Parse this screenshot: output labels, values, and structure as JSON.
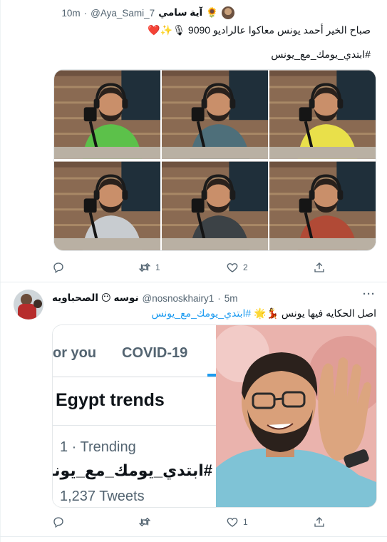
{
  "tweet1": {
    "display_name": "آية سامي",
    "name_emoji": "🌻",
    "handle": "@Aya_Sami_7",
    "dot": "·",
    "time": "10m",
    "text_line1": "صباح الخير أحمد يونس معاكوا عالراديو 9090",
    "text_emojis": "🎙✨❤️",
    "hashtag": "#ابتدي_يومك_مع_يونس",
    "actions": {
      "reply_count": "",
      "retweet_count": "1",
      "like_count": "2"
    }
  },
  "tweet2": {
    "display_name": "نوسه 😶 الصحباويه",
    "handle": "@nosnoskhairy1",
    "dot": "·",
    "time": "5m",
    "text_prefix": "اصل الحكايه فيها يونس",
    "text_emojis": "💃🌟",
    "hashtag": "#ابتدي_يومك_مع_يونس",
    "more": "···",
    "actions": {
      "reply_count": "",
      "retweet_count": "",
      "like_count": "1"
    },
    "image": {
      "tab_for_you": "or you",
      "tab_covid": "COVID-19",
      "section_title": "Egypt trends",
      "trend_rank": "1 · Trending",
      "trend_tag": "#ابتدي_يومك_مع_يونس",
      "trend_tweets": "1,237 Tweets"
    }
  },
  "colors": {
    "accent": "#1d9bf0",
    "muted": "#536471",
    "shirts": [
      "#5cc14a",
      "#4e6f7a",
      "#e9e04a",
      "#c8ccd0",
      "#3c4246",
      "#b14a36"
    ]
  }
}
